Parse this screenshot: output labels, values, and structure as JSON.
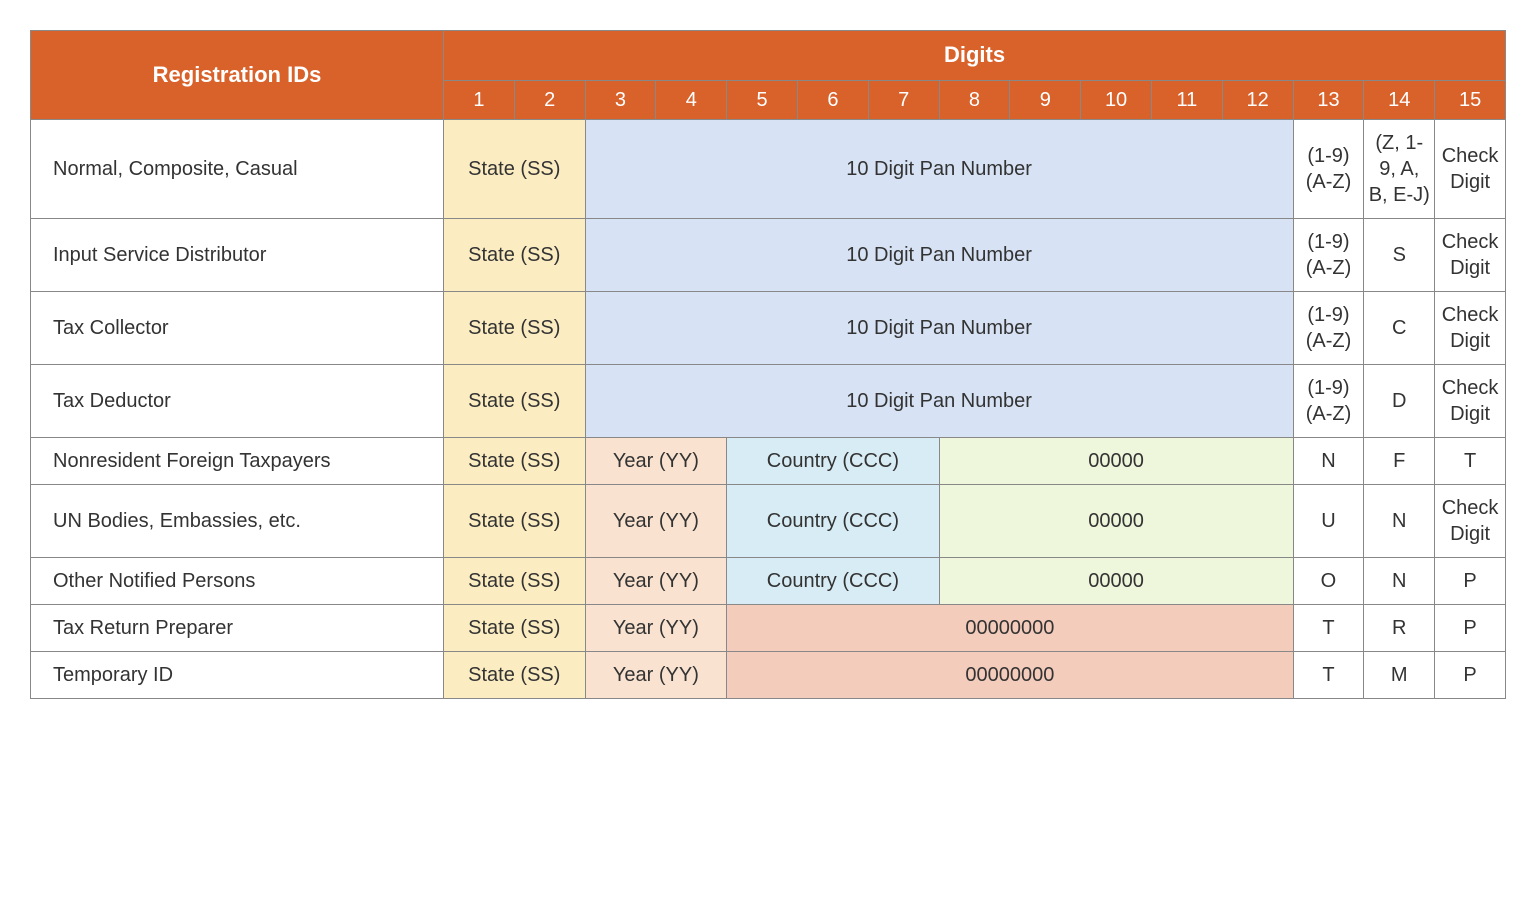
{
  "header": {
    "reg_ids": "Registration IDs",
    "digits": "Digits",
    "nums": [
      "1",
      "2",
      "3",
      "4",
      "5",
      "6",
      "7",
      "8",
      "9",
      "10",
      "11",
      "12",
      "13",
      "14",
      "15"
    ]
  },
  "cells": {
    "state": "State (SS)",
    "year": "Year (YY)",
    "country": "Country (CCC)",
    "pan10": "10 Digit Pan Number",
    "z5": "00000",
    "z8": "00000000",
    "d19az": "(1-9) (A-Z)",
    "z14a": "(Z, 1-9, A, B, E-J)",
    "check": "Check Digit",
    "S": "S",
    "C": "C",
    "D": "D",
    "N": "N",
    "F": "F",
    "T": "T",
    "U": "U",
    "O": "O",
    "P": "P",
    "R": "R",
    "M": "M"
  },
  "rows": {
    "r1": "Normal, Composite, Casual",
    "r2": "Input Service Distributor",
    "r3": "Tax Collector",
    "r4": "Tax Deductor",
    "r5": "Nonresident Foreign Taxpayers",
    "r6": "UN Bodies, Embassies, etc.",
    "r7": "Other Notified Persons",
    "r8": "Tax Return Preparer",
    "r9": "Temporary ID"
  }
}
